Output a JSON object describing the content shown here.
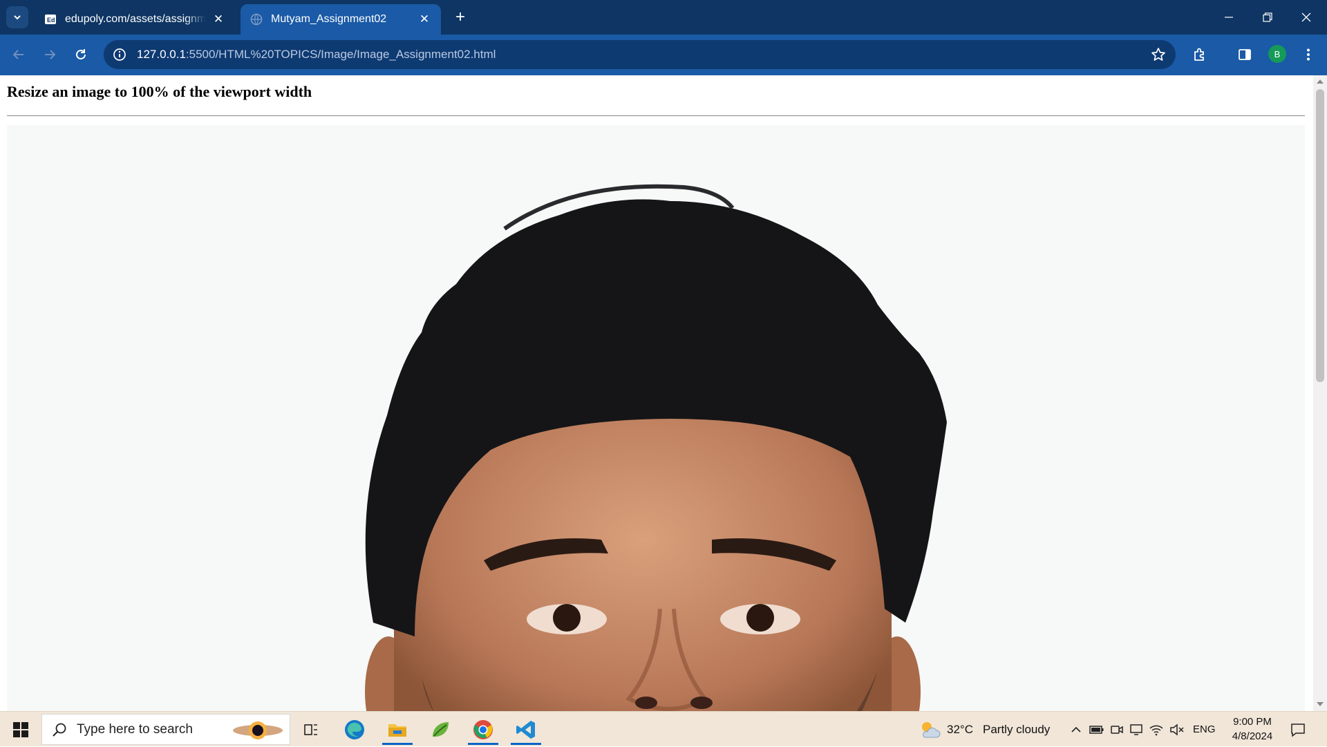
{
  "browser": {
    "tabs": [
      {
        "title": "edupoly.com/assets/assignmen",
        "active": false
      },
      {
        "title": "Mutyam_Assignment02",
        "active": true
      }
    ],
    "address": {
      "host": "127.0.0.1",
      "path": ":5500/HTML%20TOPICS/Image/Image_Assignment02.html"
    },
    "profile_initial": "B",
    "accent": "#1a5aa6",
    "frame_color": "#0e3563"
  },
  "page": {
    "heading": "Resize an image to 100% of the viewport width"
  },
  "taskbar": {
    "search_placeholder": "Type here to search",
    "weather_temp": "32°C",
    "weather_text": "Partly cloudy",
    "language": "ENG",
    "time": "9:00 PM",
    "date": "4/8/2024"
  }
}
